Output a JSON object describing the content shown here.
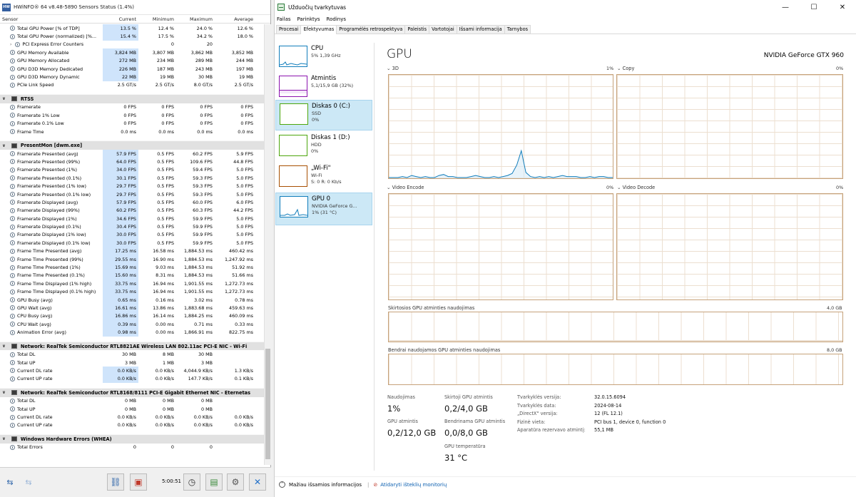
{
  "hwinfo": {
    "title": "HWiNFO® 64 v8.48-5890 Sensors Status (1.4%)",
    "columns": [
      "Sensor",
      "Current",
      "Minimum",
      "Maximum",
      "Average"
    ],
    "groups": [
      {
        "title": "",
        "rows": [
          {
            "name": "Total GPU Power [% of TDP]",
            "cur": "13.5 %",
            "min": "12.4 %",
            "max": "24.0 %",
            "avg": "12.6 %",
            "hl": true
          },
          {
            "name": "Total GPU Power (normalized) [%...",
            "cur": "15.4 %",
            "min": "17.5 %",
            "max": "34.2 %",
            "avg": "18.0 %",
            "hl": true
          },
          {
            "name": "PCI Express Error Counters",
            "cur": "",
            "min": "0",
            "max": "20",
            "avg": "",
            "sub": true
          },
          {
            "name": "GPU Memory Available",
            "cur": "3,824 MB",
            "min": "3,807 MB",
            "max": "3,862 MB",
            "avg": "3,852 MB",
            "hl": true
          },
          {
            "name": "GPU Memory Allocated",
            "cur": "272 MB",
            "min": "234 MB",
            "max": "289 MB",
            "avg": "244 MB",
            "hl": true
          },
          {
            "name": "GPU D3D Memory Dedicated",
            "cur": "226 MB",
            "min": "187 MB",
            "max": "243 MB",
            "avg": "197 MB",
            "hl": true
          },
          {
            "name": "GPU D3D Memory Dynamic",
            "cur": "22 MB",
            "min": "19 MB",
            "max": "30 MB",
            "avg": "19 MB",
            "hl": true
          },
          {
            "name": "PCIe Link Speed",
            "cur": "2.5 GT/s",
            "min": "2.5 GT/s",
            "max": "8.0 GT/s",
            "avg": "2.5 GT/s"
          }
        ]
      },
      {
        "title": "RTSS",
        "rows": [
          {
            "name": "Framerate",
            "cur": "0 FPS",
            "min": "0 FPS",
            "max": "0 FPS",
            "avg": "0 FPS"
          },
          {
            "name": "Framerate 1% Low",
            "cur": "0 FPS",
            "min": "0 FPS",
            "max": "0 FPS",
            "avg": "0 FPS"
          },
          {
            "name": "Framerate 0.1% Low",
            "cur": "0 FPS",
            "min": "0 FPS",
            "max": "0 FPS",
            "avg": "0 FPS"
          },
          {
            "name": "Frame Time",
            "cur": "0.0 ms",
            "min": "0.0 ms",
            "max": "0.0 ms",
            "avg": "0.0 ms"
          }
        ]
      },
      {
        "title": "PresentMon [dwm.exe]",
        "rows": [
          {
            "name": "Framerate Presented (avg)",
            "cur": "57.9 FPS",
            "min": "0.5 FPS",
            "max": "60.2 FPS",
            "avg": "5.9 FPS",
            "hl": true
          },
          {
            "name": "Framerate Presented (99%)",
            "cur": "64.0 FPS",
            "min": "0.5 FPS",
            "max": "109.6 FPS",
            "avg": "44.8 FPS",
            "hl": true
          },
          {
            "name": "Framerate Presented (1%)",
            "cur": "34.0 FPS",
            "min": "0.5 FPS",
            "max": "59.4 FPS",
            "avg": "5.0 FPS",
            "hl": true
          },
          {
            "name": "Framerate Presented (0.1%)",
            "cur": "30.1 FPS",
            "min": "0.5 FPS",
            "max": "59.3 FPS",
            "avg": "5.0 FPS",
            "hl": true
          },
          {
            "name": "Framerate Presented (1% low)",
            "cur": "29.7 FPS",
            "min": "0.5 FPS",
            "max": "59.3 FPS",
            "avg": "5.0 FPS",
            "hl": true
          },
          {
            "name": "Framerate Presented (0.1% low)",
            "cur": "29.7 FPS",
            "min": "0.5 FPS",
            "max": "59.3 FPS",
            "avg": "5.0 FPS",
            "hl": true
          },
          {
            "name": "Framerate Displayed (avg)",
            "cur": "57.9 FPS",
            "min": "0.5 FPS",
            "max": "60.0 FPS",
            "avg": "6.0 FPS",
            "hl": true
          },
          {
            "name": "Framerate Displayed (99%)",
            "cur": "60.2 FPS",
            "min": "0.5 FPS",
            "max": "60.3 FPS",
            "avg": "44.2 FPS",
            "hl": true
          },
          {
            "name": "Framerate Displayed (1%)",
            "cur": "34.6 FPS",
            "min": "0.5 FPS",
            "max": "59.9 FPS",
            "avg": "5.0 FPS",
            "hl": true
          },
          {
            "name": "Framerate Displayed (0.1%)",
            "cur": "30.4 FPS",
            "min": "0.5 FPS",
            "max": "59.9 FPS",
            "avg": "5.0 FPS",
            "hl": true
          },
          {
            "name": "Framerate Displayed (1% low)",
            "cur": "30.0 FPS",
            "min": "0.5 FPS",
            "max": "59.9 FPS",
            "avg": "5.0 FPS",
            "hl": true
          },
          {
            "name": "Framerate Displayed (0.1% low)",
            "cur": "30.0 FPS",
            "min": "0.5 FPS",
            "max": "59.9 FPS",
            "avg": "5.0 FPS",
            "hl": true
          },
          {
            "name": "Frame Time Presented (avg)",
            "cur": "17.25 ms",
            "min": "16.58 ms",
            "max": "1,884.53 ms",
            "avg": "460.42 ms",
            "hl": true
          },
          {
            "name": "Frame Time Presented (99%)",
            "cur": "29.55 ms",
            "min": "16.90 ms",
            "max": "1,884.53 ms",
            "avg": "1,247.92 ms",
            "hl": true
          },
          {
            "name": "Frame Time Presented (1%)",
            "cur": "15.69 ms",
            "min": "9.03 ms",
            "max": "1,884.53 ms",
            "avg": "51.92 ms",
            "hl": true
          },
          {
            "name": "Frame Time Presented (0.1%)",
            "cur": "15.60 ms",
            "min": "8.31 ms",
            "max": "1,884.53 ms",
            "avg": "51.66 ms",
            "hl": true
          },
          {
            "name": "Frame Time Displayed (1% high)",
            "cur": "33.75 ms",
            "min": "16.94 ms",
            "max": "1,901.55 ms",
            "avg": "1,272.73 ms",
            "hl": true
          },
          {
            "name": "Frame Time Displayed (0.1% high)",
            "cur": "33.75 ms",
            "min": "16.94 ms",
            "max": "1,901.55 ms",
            "avg": "1,272.73 ms",
            "hl": true
          },
          {
            "name": "GPU Busy (avg)",
            "cur": "0.65 ms",
            "min": "0.16 ms",
            "max": "3.02 ms",
            "avg": "0.78 ms",
            "hl": true
          },
          {
            "name": "GPU Wait (avg)",
            "cur": "16.61 ms",
            "min": "13.86 ms",
            "max": "1,883.68 ms",
            "avg": "459.63 ms",
            "hl": true
          },
          {
            "name": "CPU Busy (avg)",
            "cur": "16.86 ms",
            "min": "16.14 ms",
            "max": "1,884.25 ms",
            "avg": "460.09 ms",
            "hl": true
          },
          {
            "name": "CPU Wait (avg)",
            "cur": "0.39 ms",
            "min": "0.00 ms",
            "max": "0.71 ms",
            "avg": "0.33 ms",
            "hl": true
          },
          {
            "name": "Animation Error (avg)",
            "cur": "0.98 ms",
            "min": "0.00 ms",
            "max": "1,866.91 ms",
            "avg": "822.75 ms",
            "hl": true
          }
        ]
      },
      {
        "title": "Network: RealTek Semiconductor RTL8821AE Wireless LAN 802.11ac PCI-E NIC - Wi-Fi",
        "rows": [
          {
            "name": "Total DL",
            "cur": "30 MB",
            "min": "8 MB",
            "max": "30 MB",
            "avg": ""
          },
          {
            "name": "Total UP",
            "cur": "3 MB",
            "min": "1 MB",
            "max": "3 MB",
            "avg": ""
          },
          {
            "name": "Current DL rate",
            "cur": "0.0 KB/s",
            "min": "0.0 KB/s",
            "max": "4,044.9 KB/s",
            "avg": "1.3 KB/s",
            "hl": true
          },
          {
            "name": "Current UP rate",
            "cur": "0.0 KB/s",
            "min": "0.0 KB/s",
            "max": "147.7 KB/s",
            "avg": "0.1 KB/s",
            "hl": true
          }
        ]
      },
      {
        "title": "Network: RealTek Semiconductor RTL8168/8111 PCI-E Gigabit Ethernet NIC - Eternetas",
        "rows": [
          {
            "name": "Total DL",
            "cur": "0 MB",
            "min": "0 MB",
            "max": "0 MB",
            "avg": ""
          },
          {
            "name": "Total UP",
            "cur": "0 MB",
            "min": "0 MB",
            "max": "0 MB",
            "avg": ""
          },
          {
            "name": "Current DL rate",
            "cur": "0.0 KB/s",
            "min": "0.0 KB/s",
            "max": "0.0 KB/s",
            "avg": "0.0 KB/s"
          },
          {
            "name": "Current UP rate",
            "cur": "0.0 KB/s",
            "min": "0.0 KB/s",
            "max": "0.0 KB/s",
            "avg": "0.0 KB/s"
          }
        ]
      },
      {
        "title": "Windows Hardware Errors (WHEA)",
        "rows": [
          {
            "name": "Total Errors",
            "cur": "0",
            "min": "0",
            "max": "0",
            "avg": ""
          }
        ]
      }
    ],
    "clock": "5:00:51"
  },
  "taskmgr": {
    "title": "Užduočių tvarkytuvas",
    "menu": [
      "Failas",
      "Parinktys",
      "Rodinys"
    ],
    "tabs": [
      "Procesai",
      "Efektyvumas",
      "Programėlės retrospektyva",
      "Paleistis",
      "Vartotojai",
      "Išsami informacija",
      "Tarnybos"
    ],
    "active_tab": 1,
    "sidebar": [
      {
        "name": "CPU",
        "l1": "5% 1,39 GHz",
        "l2": "",
        "color": "#117dbb"
      },
      {
        "name": "Atmintis",
        "l1": "5,1/15,9 GB (32%)",
        "l2": "",
        "color": "#8b12ae"
      },
      {
        "name": "Diskas 0 (C:)",
        "l1": "SSD",
        "l2": "0%",
        "color": "#4da60c"
      },
      {
        "name": "Diskas 1 (D:)",
        "l1": "HDD",
        "l2": "0%",
        "color": "#4da60c"
      },
      {
        "name": "„Wi-Fi\"",
        "l1": "Wi-Fi",
        "l2": "S: 0 R: 0 Kb/s",
        "color": "#a74f01"
      },
      {
        "name": "GPU 0",
        "l1": "NVIDIA GeForce G...",
        "l2": "1% (31 °C)",
        "color": "#117dbb"
      }
    ],
    "gpu": {
      "heading": "GPU",
      "model": "NVIDIA GeForce GTX 960",
      "engines": [
        {
          "label": "3D",
          "pct": "1%"
        },
        {
          "label": "Copy",
          "pct": "0%"
        },
        {
          "label": "Video Encode",
          "pct": "0%"
        },
        {
          "label": "Video Decode",
          "pct": "0%"
        }
      ],
      "dedicated_label": "Skirtosios GPU atminties naudojimas",
      "dedicated_max": "4,0 GB",
      "shared_label": "Bendrai naudojamos GPU atminties naudojimas",
      "shared_max": "8,0 GB",
      "stats": {
        "util_label": "Naudojimas",
        "util": "1%",
        "ded_label": "Skirtoji GPU atmintis",
        "ded": "0,2/4,0 GB",
        "gpumem_label": "GPU atmintis",
        "gpumem": "0,2/12,0 GB",
        "shared_label": "Bendrinama GPU atmintis",
        "shared": "0,0/8,0 GB",
        "temp_label": "GPU temperatūra",
        "temp": "31 °C"
      },
      "details": [
        {
          "k": "Tvarkyklės versija:",
          "v": "32.0.15.6094"
        },
        {
          "k": "Tvarkyklės data:",
          "v": "2024-08-14"
        },
        {
          "k": "„DirectX\" versija:",
          "v": "12 (FL 12.1)"
        },
        {
          "k": "Fizinė vieta:",
          "v": "PCI bus 1, device 0, function 0"
        },
        {
          "k": "Aparatūra rezervavo atmintį:",
          "v": "55,1 MB"
        }
      ],
      "spark_3d": [
        0,
        0,
        0,
        1,
        0,
        2,
        1,
        0,
        1,
        0,
        0,
        2,
        3,
        1,
        1,
        0,
        0,
        0,
        1,
        2,
        1,
        0,
        0,
        1,
        0,
        1,
        2,
        4,
        12,
        26,
        5,
        1,
        0,
        1,
        0,
        1,
        0,
        1,
        2,
        1,
        1,
        1,
        0,
        0,
        1,
        0,
        1,
        1,
        0,
        0
      ]
    },
    "footer_less": "Mažiau išsamios informacijos",
    "footer_monitor": "Atidaryti išteklių monitorių"
  }
}
